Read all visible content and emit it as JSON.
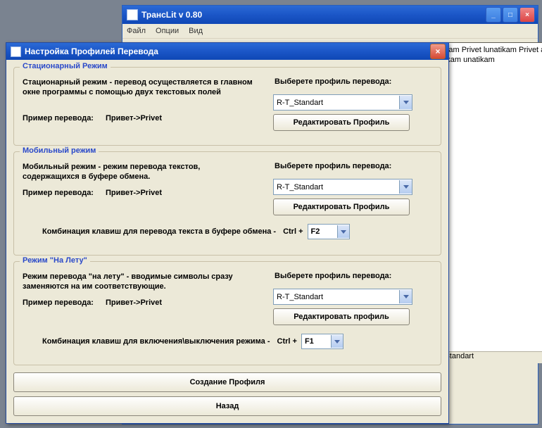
{
  "app": {
    "title": "ТрансLit v 0.80",
    "menu": {
      "file": "Файл",
      "options": "Опции",
      "view": "Вид"
    },
    "textarea": "unatikam Privet lunatikam Privet\nam Privet lunatikam Privet lunatikam\nunatikam",
    "status_profile": "R-T_Standart"
  },
  "dialog": {
    "title": "Настройка Профилей Перевода",
    "stationary": {
      "legend": "Стационарный Режим",
      "desc": "Стационарный режим - перевод осуществляется в главном окне программы с помощью двух текстовых полей",
      "example_label": "Пример перевода:",
      "example_value": "Привет->Privet",
      "select_label": "Выберете профиль перевода:",
      "profile": "R-T_Standart",
      "edit_btn": "Редактировать Профиль"
    },
    "mobile": {
      "legend": "Мобильный режим",
      "desc": "Мобильный режим - режим перевода текстов, содержащихся в буфере обмена.",
      "example_label": "Пример перевода:",
      "example_value": "Привет->Privet",
      "select_label": "Выберете профиль перевода:",
      "profile": "R-T_Standart",
      "edit_btn": "Редактировать Профиль",
      "hotkey_label": "Комбинация клавиш для перевода текста в буфере обмена -",
      "hotkey_mod": "Ctrl +",
      "hotkey_key": "F2"
    },
    "onfly": {
      "legend": "Режим \"На Лету\"",
      "desc": "Режим перевода \"на лету\" - вводимые символы сразу заменяются на им соответствующие.",
      "example_label": "Пример перевода:",
      "example_value": "Привет->Privet",
      "select_label": "Выберете профиль перевода:",
      "profile": "R-T_Standart",
      "edit_btn": "Редактировать профиль",
      "hotkey_label": "Комбинация клавиш для включения\\выключения режима -",
      "hotkey_mod": "Ctrl +",
      "hotkey_key": "F1"
    },
    "create_btn": "Создание Профиля",
    "back_btn": "Назад"
  }
}
